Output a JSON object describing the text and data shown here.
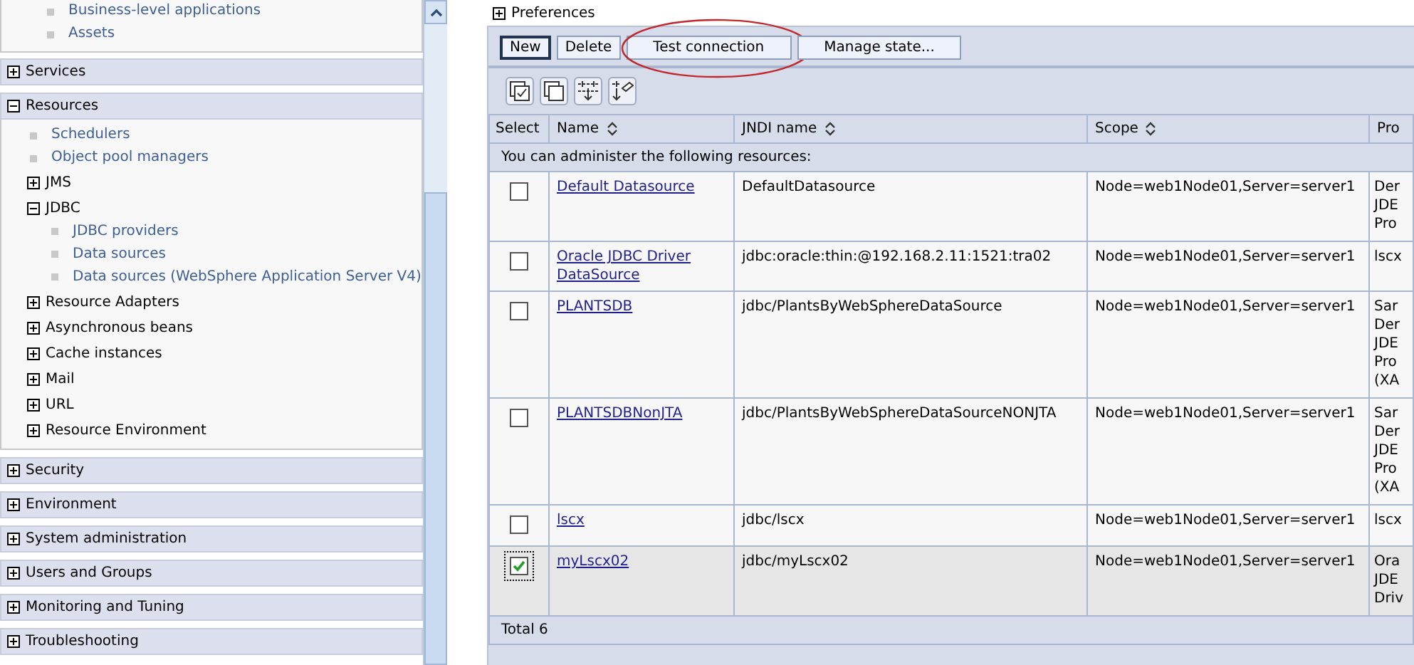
{
  "sidebar": {
    "top_links": [
      "Business-level applications",
      "Assets"
    ],
    "sections": [
      {
        "label": "Services",
        "expanded": false
      },
      {
        "label": "Resources",
        "expanded": true,
        "children": [
          {
            "kind": "link",
            "label": "Schedulers"
          },
          {
            "kind": "link",
            "label": "Object pool managers"
          },
          {
            "kind": "node",
            "label": "JMS",
            "expanded": false
          },
          {
            "kind": "node",
            "label": "JDBC",
            "expanded": true,
            "children": [
              {
                "kind": "link",
                "label": "JDBC providers"
              },
              {
                "kind": "link",
                "label": "Data sources"
              },
              {
                "kind": "link",
                "label": "Data sources (WebSphere Application Server V4)"
              }
            ]
          },
          {
            "kind": "node",
            "label": "Resource Adapters",
            "expanded": false
          },
          {
            "kind": "node",
            "label": "Asynchronous beans",
            "expanded": false
          },
          {
            "kind": "node",
            "label": "Cache instances",
            "expanded": false
          },
          {
            "kind": "node",
            "label": "Mail",
            "expanded": false
          },
          {
            "kind": "node",
            "label": "URL",
            "expanded": false
          },
          {
            "kind": "node",
            "label": "Resource Environment",
            "expanded": false
          }
        ]
      },
      {
        "label": "Security",
        "expanded": false
      },
      {
        "label": "Environment",
        "expanded": false
      },
      {
        "label": "System administration",
        "expanded": false
      },
      {
        "label": "Users and Groups",
        "expanded": false
      },
      {
        "label": "Monitoring and Tuning",
        "expanded": false
      },
      {
        "label": "Troubleshooting",
        "expanded": false
      }
    ]
  },
  "preferences": {
    "label": "Preferences",
    "expanded": false
  },
  "buttons": [
    {
      "label": "New",
      "focused": true
    },
    {
      "label": "Delete",
      "focused": false
    },
    {
      "label": "Test connection",
      "focused": false,
      "annotated": true
    },
    {
      "label": "Manage state...",
      "focused": false,
      "annotated": false
    }
  ],
  "table": {
    "columns": [
      "Select",
      "Name",
      "JNDI name",
      "Scope",
      "Pro"
    ],
    "caption": "You can administer the following resources:",
    "rows": [
      {
        "name": "Default Datasource",
        "jndi": "DefaultDatasource",
        "scope": "Node=web1Node01,Server=server1",
        "column_5": [
          "Der",
          "JDE",
          "Pro"
        ],
        "checked": false
      },
      {
        "name": "Oracle JDBC Driver DataSource",
        "jndi": "jdbc:oracle:thin:@192.168.2.11:1521:tra02",
        "scope": "Node=web1Node01,Server=server1",
        "column_5": [
          "lscx"
        ],
        "checked": false
      },
      {
        "name": "PLANTSDB",
        "jndi": "jdbc/PlantsByWebSphereDataSource",
        "scope": "Node=web1Node01,Server=server1",
        "column_5": [
          "Sar",
          "Der",
          "JDE",
          "Pro",
          "(XA"
        ],
        "checked": false
      },
      {
        "name": "PLANTSDBNonJTA",
        "jndi": "jdbc/PlantsByWebSphereDataSourceNONJTA",
        "scope": "Node=web1Node01,Server=server1",
        "column_5": [
          "Sar",
          "Der",
          "JDE",
          "Pro",
          "(XA"
        ],
        "checked": false
      },
      {
        "name": "lscx",
        "jndi": "jdbc/lscx",
        "scope": "Node=web1Node01,Server=server1",
        "column_5": [
          "lscx"
        ],
        "checked": false
      },
      {
        "name": "myLscx02",
        "jndi": "jdbc/myLscx02",
        "scope": "Node=web1Node01,Server=server1",
        "column_5": [
          "Ora",
          "JDE",
          "Driv"
        ],
        "checked": true
      }
    ],
    "total": "Total 6"
  }
}
